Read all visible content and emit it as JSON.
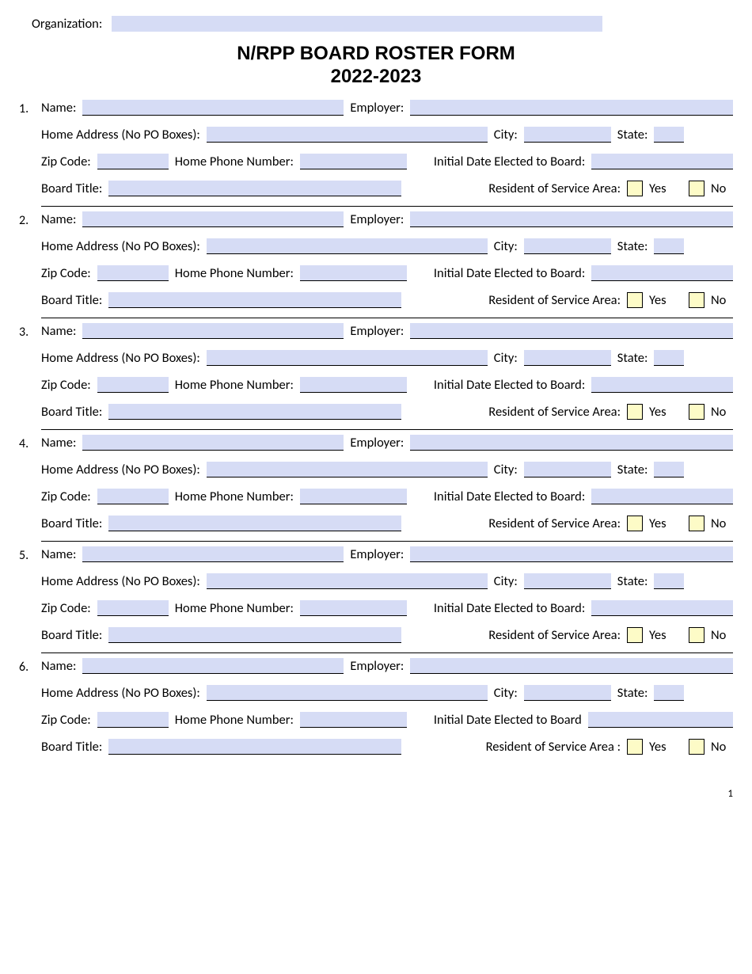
{
  "header": {
    "organization_label": "Organization:",
    "title_line1": "N/RPP BOARD ROSTER FORM",
    "title_line2": "2022-2023"
  },
  "labels": {
    "name": "Name:",
    "employer": "Employer:",
    "home_address": "Home Address (No PO Boxes):",
    "city": "City:",
    "state": "State:",
    "zip": "Zip Code:",
    "home_phone": "Home Phone Number:",
    "initial_date": "Initial Date Elected to Board:",
    "initial_date_nc": "Initial Date Elected to Board",
    "board_title": "Board Title:",
    "resident": "Resident of Service Area:",
    "resident_sp": "Resident of Service Area :",
    "yes": "Yes",
    "no": "No"
  },
  "entries": [
    {
      "n": "1."
    },
    {
      "n": "2."
    },
    {
      "n": "3."
    },
    {
      "n": "4."
    },
    {
      "n": "5."
    },
    {
      "n": "6."
    }
  ],
  "footer": {
    "page": "1"
  }
}
